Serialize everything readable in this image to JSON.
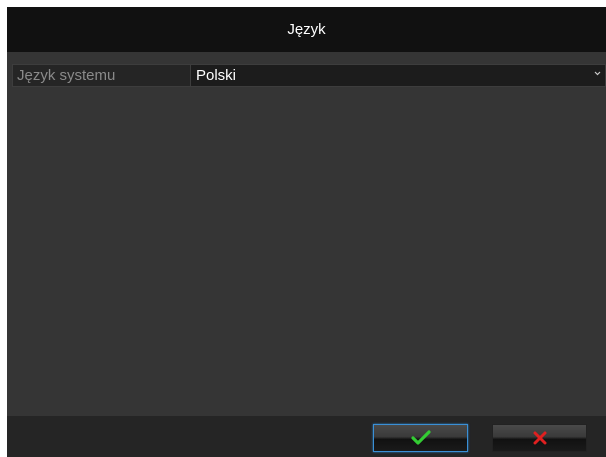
{
  "dialog": {
    "title": "Język"
  },
  "settings": {
    "language_label": "Język systemu",
    "language_value": "Polski"
  },
  "colors": {
    "titlebar_bg": "#111111",
    "body_bg": "#353535",
    "footer_bg": "#252525",
    "ok_icon": "#33cc33",
    "cancel_icon": "#e02020",
    "focus_border": "#3a8fd6"
  },
  "icons": {
    "dropdown": "chevron-down-icon",
    "confirm": "checkmark-icon",
    "cancel": "close-icon"
  }
}
